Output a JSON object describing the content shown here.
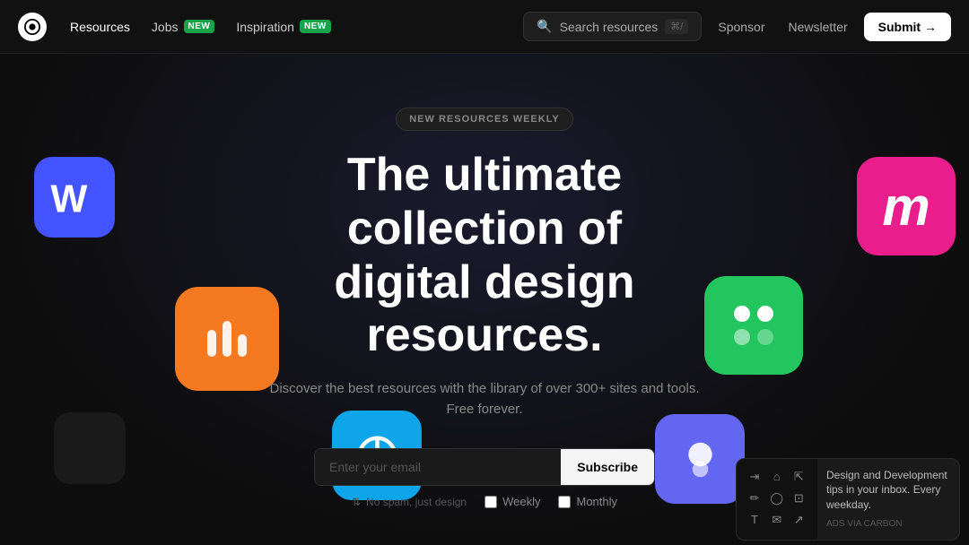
{
  "nav": {
    "logo_alt": "Logo",
    "links": [
      {
        "id": "resources",
        "label": "Resources",
        "active": true,
        "badge": null
      },
      {
        "id": "jobs",
        "label": "Jobs",
        "active": false,
        "badge": {
          "text": "NEW",
          "color": "green"
        }
      },
      {
        "id": "inspiration",
        "label": "Inspiration",
        "active": false,
        "badge": {
          "text": "NEW",
          "color": "green"
        }
      }
    ],
    "search_label": "Search resources",
    "search_shortcut": "⌘/",
    "sponsor_label": "Sponsor",
    "newsletter_label": "Newsletter",
    "submit_label": "Submit →"
  },
  "hero": {
    "badge": "NEW RESOURCES WEEKLY",
    "title": "The ultimate collection of\ndigital design resources.",
    "subtitle": "Discover the best resources with the library of over 300+ sites and tools. Free forever.",
    "email_placeholder": "Enter your email",
    "subscribe_label": "Subscribe",
    "form_hint": "No spam, just design",
    "weekly_label": "Weekly",
    "monthly_label": "Monthly"
  },
  "ads": {
    "text": "Design and Development tips in your inbox. Every weekday.",
    "via": "ADS VIA CARBON"
  },
  "icons": {
    "webflow_letter": "W",
    "mockup_letter": "m",
    "taskheat_color": "#f47920",
    "pockity_color": "#22c55e"
  }
}
